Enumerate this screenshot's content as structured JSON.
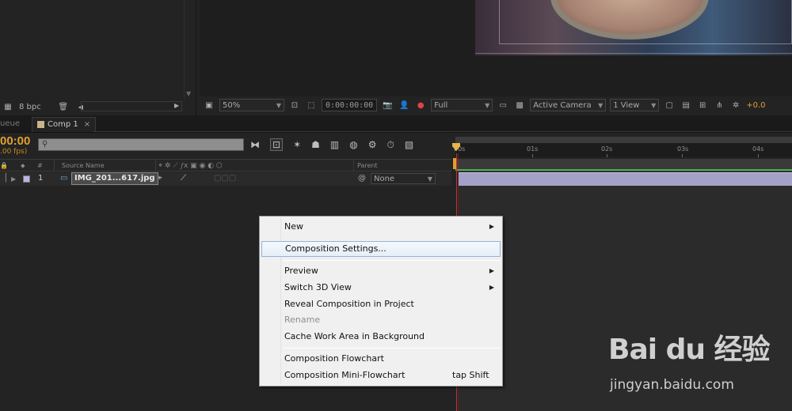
{
  "project_panel": {
    "bit_depth": "8 bpc"
  },
  "viewer_toolbar": {
    "zoom": "50%",
    "timecode": "0:00:00:00",
    "resolution": "Full",
    "camera": "Active Camera",
    "views": "1 View",
    "exposure": "+0.0"
  },
  "tabs": {
    "queue_partial": "ueue",
    "comp_label": "Comp 1",
    "close_glyph": "×"
  },
  "timeline": {
    "current_time": "00:00",
    "fps": ".00 fps)",
    "search_placeholder": "",
    "ruler_ticks": [
      "00s",
      "01s",
      "02s",
      "03s",
      "04s"
    ],
    "columns": {
      "hash": "#",
      "source_name": "Source Name",
      "parent": "Parent"
    },
    "layer": {
      "index": "1",
      "name": "IMG_201...617.jpg",
      "parent_value": "None"
    }
  },
  "context_menu": {
    "items": [
      {
        "label": "New",
        "submenu": true
      },
      {
        "label": "Composition Settings...",
        "highlighted": true
      },
      {
        "label": "Preview",
        "submenu": true
      },
      {
        "label": "Switch 3D View",
        "submenu": true
      },
      {
        "label": "Reveal Composition in Project"
      },
      {
        "label": "Rename",
        "disabled": true
      },
      {
        "label": "Cache Work Area in Background"
      },
      {
        "label": "Composition Flowchart"
      },
      {
        "label": "Composition Mini-Flowchart",
        "shortcut": "tap Shift"
      }
    ]
  },
  "watermark": {
    "logo": "Bai du 经验",
    "url": "jingyan.baidu.com"
  },
  "colors": {
    "accent_orange": "#e0a030",
    "playhead_red": "#c43030",
    "layer_bar": "#a3a1c8",
    "work_area_green": "#4ab04a"
  }
}
